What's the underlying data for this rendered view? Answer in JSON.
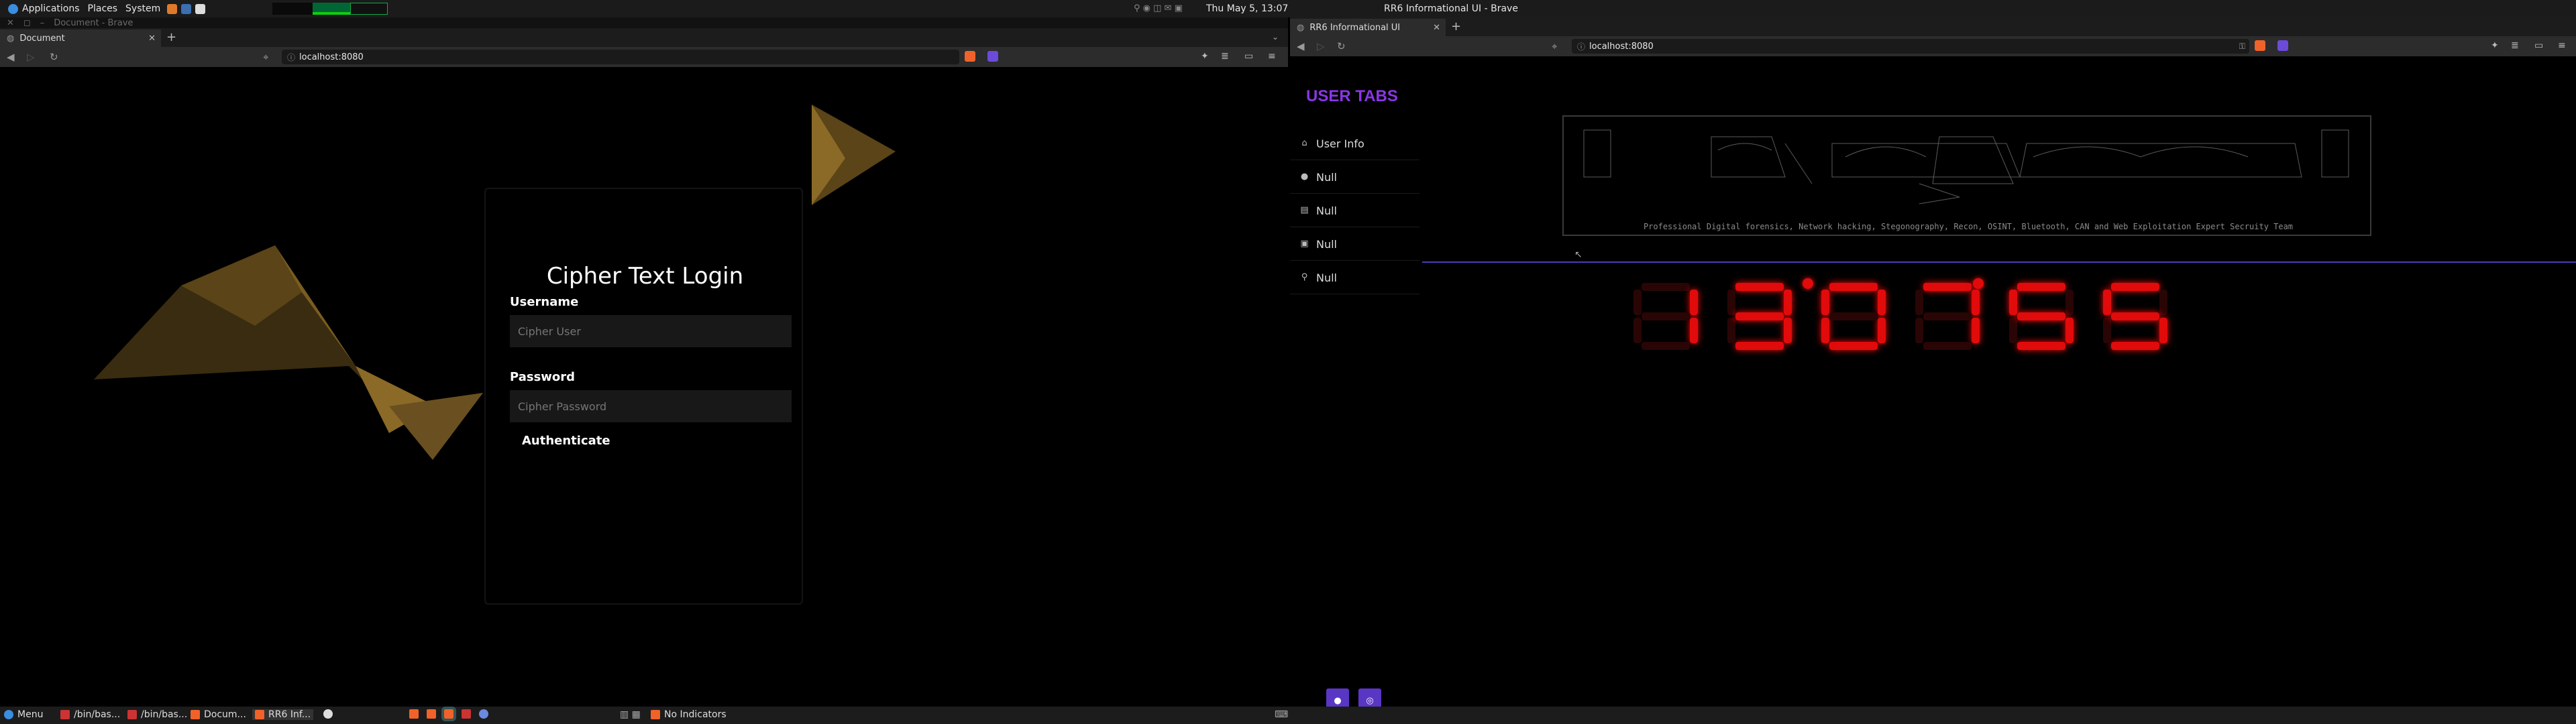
{
  "top_panel": {
    "applications": "Applications",
    "places": "Places",
    "system": "System",
    "clock": "Thu May 5, 13:07",
    "window_title": "RR6 Informational UI - Brave"
  },
  "left_browser": {
    "window_title": "Document - Brave",
    "tab_title": "Document",
    "url": "localhost:8080"
  },
  "login": {
    "title": "Cipher Text Login",
    "username_label": "Username",
    "username_placeholder": "Cipher User",
    "password_label": "Password",
    "password_placeholder": "Cipher Password",
    "submit_label": "Authenticate"
  },
  "right_browser": {
    "tab_title": "RR6 Informational UI",
    "url": "localhost:8080"
  },
  "sidebar": {
    "title": "USER TABS",
    "items": [
      {
        "label": "User Info",
        "icon": "home-icon"
      },
      {
        "label": "Null",
        "icon": "user-icon"
      },
      {
        "label": "Null",
        "icon": "id-card-icon"
      },
      {
        "label": "Null",
        "icon": "contact-icon"
      },
      {
        "label": "Null",
        "icon": "pin-icon"
      }
    ]
  },
  "banner": {
    "tagline": "Professional Digital forensics, Network hacking, Stegonography, Recon, OSINT, Bluetooth, CAN and Web Exploitation Expert Secruity Team"
  },
  "clock": {
    "digits": [
      "1",
      "3",
      "0",
      "7",
      "5",
      "5"
    ],
    "color": "#e10b0b"
  },
  "social": {
    "github": "github-icon",
    "instagram": "instagram-icon"
  },
  "taskbar": {
    "menu": "Menu",
    "items": [
      "/bin/bas...",
      "/bin/bas...",
      "Docum...",
      "RR6 Inf..."
    ],
    "indicators": "No Indicators"
  },
  "colors": {
    "accent_purple": "#8a36e6",
    "divider": "#4b3cb8",
    "gold": "#c9a94a"
  }
}
